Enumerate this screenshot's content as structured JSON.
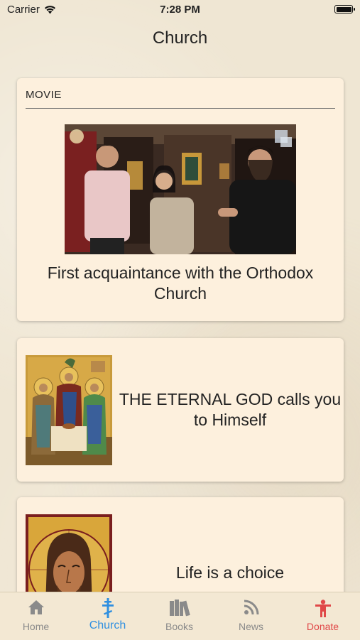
{
  "status_bar": {
    "carrier": "Carrier",
    "time": "7:28 PM"
  },
  "nav": {
    "title": "Church"
  },
  "cards": [
    {
      "header": "MOVIE",
      "title": "First acquaintance with the Orthodox Church"
    },
    {
      "title": "THE ETERNAL GOD calls you to Himself"
    },
    {
      "title": "Life is a choice"
    }
  ],
  "tabs": [
    {
      "label": "Home",
      "icon": "home-icon"
    },
    {
      "label": "Church",
      "icon": "orthodox-cross-icon",
      "active": true
    },
    {
      "label": "Books",
      "icon": "books-icon"
    },
    {
      "label": "News",
      "icon": "rss-icon"
    },
    {
      "label": "Donate",
      "icon": "person-icon"
    }
  ],
  "colors": {
    "active_tab": "#2f8fe0",
    "donate_tab": "#e04848",
    "card_bg": "#fdf0dd"
  }
}
